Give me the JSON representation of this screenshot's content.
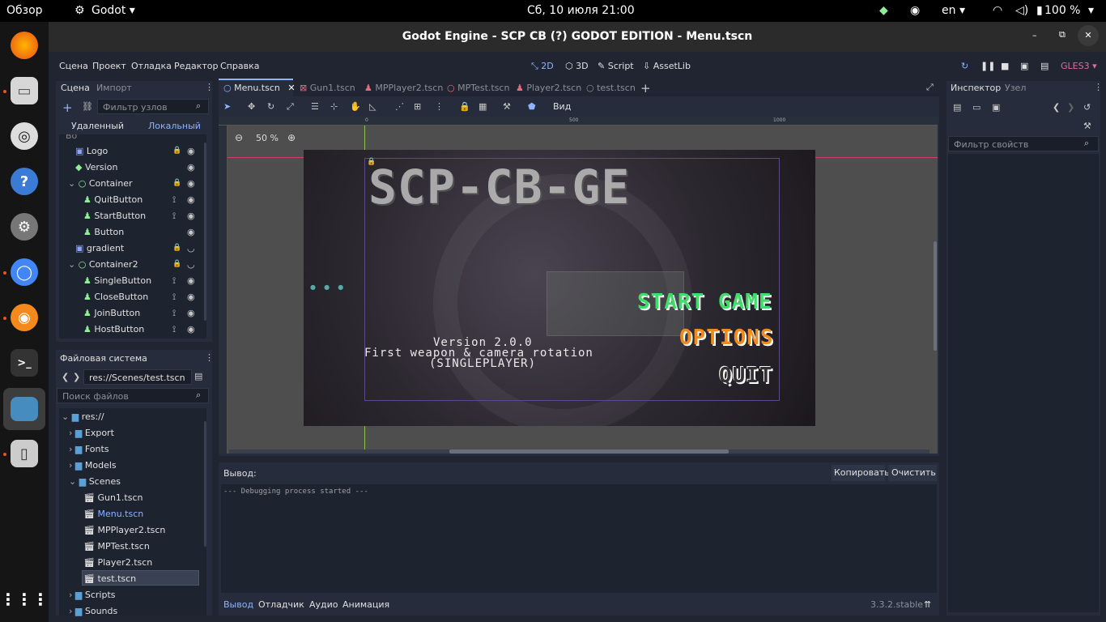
{
  "topbar": {
    "overview": "Обзор",
    "app": "Godot",
    "datetime": "Сб, 10 июля  21:00",
    "lang": "en",
    "battery": "100 %"
  },
  "window": {
    "title": "Godot Engine - SCP CB (?) GODOT EDITION - Menu.tscn"
  },
  "menu": {
    "scene": "Сцена",
    "project": "Проект",
    "debug": "Отладка",
    "editor": "Редактор",
    "help": "Справка"
  },
  "modes": {
    "m2d": "2D",
    "m3d": "3D",
    "script": "Script",
    "assetlib": "AssetLib"
  },
  "renderer": "GLES3",
  "scene_dock": {
    "tab_scene": "Сцена",
    "tab_import": "Импорт",
    "filter_placeholder": "Фильтр узлов",
    "remote": "Удаленный",
    "local": "Локальный",
    "nodes": [
      {
        "label": "Logo",
        "color": "#8da5f3"
      },
      {
        "label": "Version",
        "color": "#8eef97"
      },
      {
        "label": "Container",
        "color": "#8eef97"
      },
      {
        "label": "QuitButton",
        "color": "#8eef97"
      },
      {
        "label": "StartButton",
        "color": "#8eef97"
      },
      {
        "label": "Button",
        "color": "#8eef97"
      },
      {
        "label": "gradient",
        "color": "#8da5f3"
      },
      {
        "label": "Container2",
        "color": "#8eef97"
      },
      {
        "label": "SingleButton",
        "color": "#8eef97"
      },
      {
        "label": "CloseButton",
        "color": "#8eef97"
      },
      {
        "label": "JoinButton",
        "color": "#8eef97"
      },
      {
        "label": "HostButton",
        "color": "#8eef97"
      }
    ]
  },
  "fs_dock": {
    "title": "Файловая система",
    "path": "res://Scenes/test.tscn",
    "search_placeholder": "Поиск файлов",
    "items": [
      {
        "label": "res://"
      },
      {
        "label": "Export"
      },
      {
        "label": "Fonts"
      },
      {
        "label": "Models"
      },
      {
        "label": "Scenes"
      },
      {
        "label": "Gun1.tscn"
      },
      {
        "label": "Menu.tscn"
      },
      {
        "label": "MPPlayer2.tscn"
      },
      {
        "label": "MPTest.tscn"
      },
      {
        "label": "Player2.tscn"
      },
      {
        "label": "test.tscn"
      },
      {
        "label": "Scripts"
      },
      {
        "label": "Sounds"
      }
    ]
  },
  "scene_tabs": [
    {
      "label": "Menu.tscn"
    },
    {
      "label": "Gun1.tscn"
    },
    {
      "label": "MPPlayer2.tscn"
    },
    {
      "label": "MPTest.tscn"
    },
    {
      "label": "Player2.tscn"
    },
    {
      "label": "test.tscn"
    }
  ],
  "toolbar": {
    "view": "Вид",
    "zoom": "50 %"
  },
  "ruler": {
    "t0": "0",
    "t500": "500",
    "t1000": "1000"
  },
  "game_preview": {
    "logo": "SCP-CB-GE",
    "version_line1": "Version 2.0.0",
    "version_line2": "First weapon & camera rotation",
    "version_line3": "(SINGLEPLAYER)",
    "start": "START GAME",
    "options": "OPTIONS",
    "quit": "QUIT"
  },
  "output": {
    "label": "Вывод:",
    "copy": "Копировать",
    "clear": "Очистить",
    "log": "--- Debugging process started ---"
  },
  "bottom_tabs": {
    "output": "Вывод",
    "debugger": "Отладчик",
    "audio": "Аудио",
    "animation": "Анимация"
  },
  "version": "3.3.2.stable",
  "inspector": {
    "tab_inspector": "Инспектор",
    "tab_node": "Узел",
    "filter_placeholder": "Фильтр свойств"
  }
}
